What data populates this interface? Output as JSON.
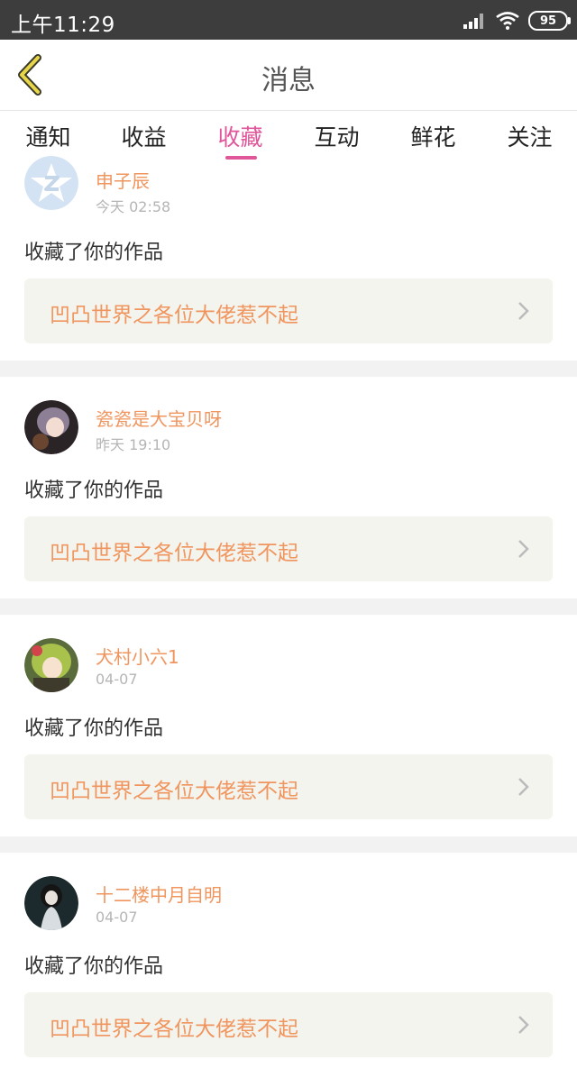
{
  "status_bar": {
    "time": "上午11:29",
    "battery": "95"
  },
  "header": {
    "title": "消息"
  },
  "tabs": [
    {
      "label": "通知",
      "active": false
    },
    {
      "label": "收益",
      "active": false
    },
    {
      "label": "收藏",
      "active": true
    },
    {
      "label": "互动",
      "active": false
    },
    {
      "label": "鲜花",
      "active": false
    },
    {
      "label": "关注",
      "active": false
    }
  ],
  "messages": [
    {
      "username": "申子辰",
      "time": "今天 02:58",
      "action": "收藏了你的作品",
      "work_title": "凹凸世界之各位大佬惹不起",
      "avatar": "qq-default-avatar"
    },
    {
      "username": "瓷瓷是大宝贝呀",
      "time": "昨天 19:10",
      "action": "收藏了你的作品",
      "work_title": "凹凸世界之各位大佬惹不起",
      "avatar": "anime-avatar"
    },
    {
      "username": "犬村小六1",
      "time": "04-07",
      "action": "收藏了你的作品",
      "work_title": "凹凸世界之各位大佬惹不起",
      "avatar": "anime-avatar"
    },
    {
      "username": "十二楼中月自明",
      "time": "04-07",
      "action": "收藏了你的作品",
      "work_title": "凹凸世界之各位大佬惹不起",
      "avatar": "anime-avatar"
    }
  ],
  "colors": {
    "accent_pink": "#e0569a",
    "orange_text": "#f0955e",
    "back_arrow": "#e8d64a"
  }
}
